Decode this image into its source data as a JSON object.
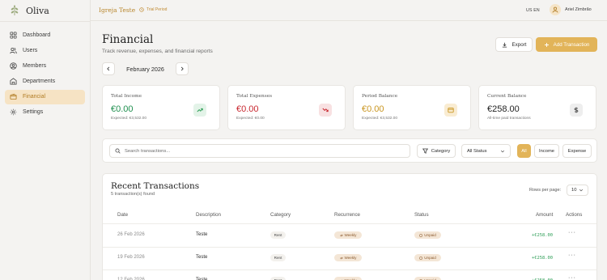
{
  "brand": {
    "name": "Oliva"
  },
  "sidebar": {
    "items": [
      {
        "label": "Dashboard",
        "icon": "dashboard-icon",
        "active": false
      },
      {
        "label": "Users",
        "icon": "users-icon",
        "active": false
      },
      {
        "label": "Members",
        "icon": "members-icon",
        "active": false
      },
      {
        "label": "Departments",
        "icon": "building-icon",
        "active": false
      },
      {
        "label": "Financial",
        "icon": "wallet-icon",
        "active": true
      },
      {
        "label": "Settings",
        "icon": "gear-icon",
        "active": false
      }
    ]
  },
  "topbar": {
    "church": "Igreja Teste",
    "trial": "Trial Period",
    "lang_us": "US",
    "lang_en": "EN",
    "user_name": "Ariel Zimbrão"
  },
  "page": {
    "title": "Financial",
    "subtitle": "Track revenue, expenses, and financial reports",
    "export_label": "Export",
    "add_label": "Add Transaction",
    "month": "February 2026"
  },
  "cards": [
    {
      "title": "Total Income",
      "value": "€0.00",
      "note": "Expected: €3,532.00",
      "color": "#1e8f4e",
      "icon": "trending-up-icon",
      "icon_bg": "#e3f3e8",
      "icon_color": "#2e9e57"
    },
    {
      "title": "Total Expenses",
      "value": "€0.00",
      "note": "Expected: €0.00",
      "color": "#c8262e",
      "icon": "trending-down-icon",
      "icon_bg": "#f8e1e2",
      "icon_color": "#c8262e"
    },
    {
      "title": "Period Balance",
      "value": "€0.00",
      "note": "Expected: €3,532.00",
      "color": "#c9951f",
      "icon": "wallet-icon",
      "icon_bg": "#f9ecd2",
      "icon_color": "#c9951f"
    },
    {
      "title": "Current Balance",
      "value": "€258.00",
      "note": "All-time paid transactions",
      "color": "#1f1f1f",
      "icon": "dollar-icon",
      "icon_bg": "#eeeeee",
      "icon_color": "#444444"
    }
  ],
  "filters": {
    "search_placeholder": "Search transactions...",
    "category_label": "Category",
    "status_value": "All Status",
    "type_all": "All",
    "type_income": "Income",
    "type_expense": "Expense"
  },
  "transactions": {
    "title": "Recent Transactions",
    "count_text": "5 transaction(s) found",
    "rows_per_page_label": "Rows per page:",
    "rows_per_page_value": "10",
    "columns": [
      "Date",
      "Description",
      "Category",
      "Recurrence",
      "Status",
      "Amount",
      "Actions"
    ],
    "rows": [
      {
        "date": "26 Feb 2026",
        "description": "Teste",
        "category": "Rent",
        "recurrence": "Weekly",
        "status": "Unpaid",
        "amount": "+€258.00"
      },
      {
        "date": "19 Feb 2026",
        "description": "Teste",
        "category": "Rent",
        "recurrence": "Weekly",
        "status": "Unpaid",
        "amount": "+€258.00"
      },
      {
        "date": "12 Feb 2026",
        "description": "Teste",
        "category": "Rent",
        "recurrence": "Weekly",
        "status": "Unpaid",
        "amount": "+€258.00"
      }
    ]
  },
  "colors": {
    "accent": "#e2b459",
    "active_bg": "#f6e3c4",
    "income_green": "#2e9e57"
  }
}
